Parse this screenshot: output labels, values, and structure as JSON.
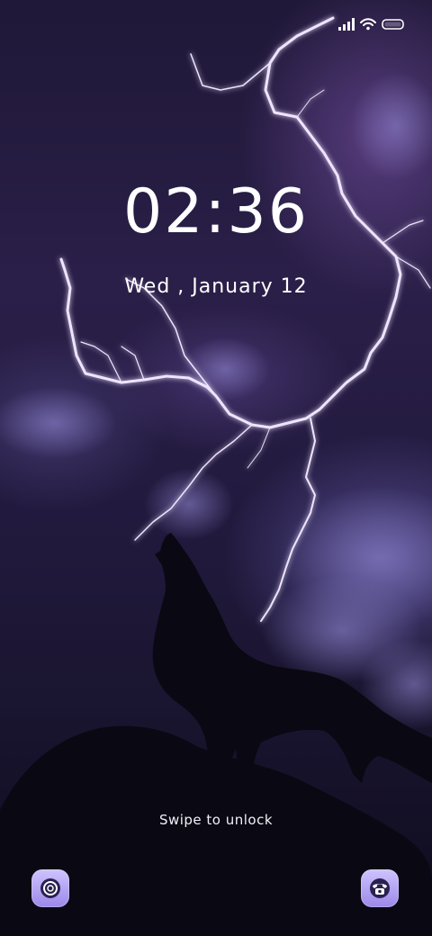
{
  "lockscreen": {
    "time": "02:36",
    "date": "Wed , January 12",
    "swipe_hint": "Swipe to unlock"
  },
  "status_bar": {
    "icons": [
      "signal-icon",
      "wifi-icon",
      "battery-icon"
    ]
  },
  "shortcuts": {
    "left": "camera-icon",
    "right": "phone-icon"
  },
  "colors": {
    "accent": "#a898f0",
    "lightning": "#e8d8ff",
    "sky_dark": "#1a1530"
  }
}
